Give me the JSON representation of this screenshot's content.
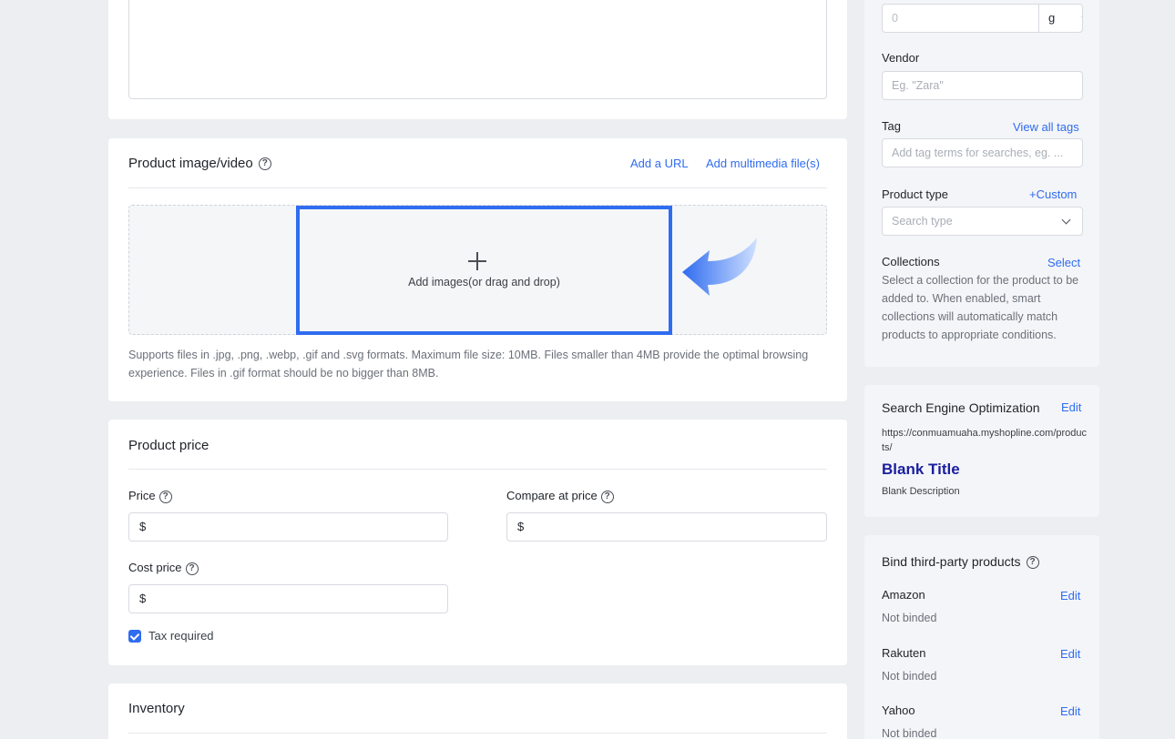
{
  "media": {
    "title": "Product image/video",
    "add_url": "Add a URL",
    "add_files": "Add multimedia file(s)",
    "drop_hint": "Add images(or drag and drop)",
    "support_text": "Supports files in .jpg, .png, .webp, .gif and .svg formats. Maximum file size: 10MB. Files smaller than 4MB provide the optimal browsing experience. Files in .gif format should be no bigger than 8MB."
  },
  "price": {
    "title": "Product price",
    "price_label": "Price",
    "compare_label": "Compare at price",
    "cost_label": "Cost price",
    "currency": "$",
    "tax_label": "Tax required",
    "tax_checked": true
  },
  "inventory": {
    "title": "Inventory"
  },
  "organization": {
    "weight_value": "0",
    "weight_unit": "g",
    "vendor_label": "Vendor",
    "vendor_placeholder": "Eg. \"Zara\"",
    "tag_label": "Tag",
    "tag_link": "View all tags",
    "tag_placeholder": "Add tag terms for searches, eg. ...",
    "type_label": "Product type",
    "type_link": "+Custom",
    "type_placeholder": "Search type",
    "collections_label": "Collections",
    "collections_link": "Select",
    "collections_desc": "Select a collection for the product to be added to. When enabled, smart collections will automatically match products to appropriate conditions."
  },
  "seo": {
    "title": "Search Engine Optimization",
    "edit": "Edit",
    "url": "https://conmuamuaha.myshopline.com/products/",
    "preview_title": "Blank Title",
    "preview_desc": "Blank Description"
  },
  "bind": {
    "title": "Bind third-party products",
    "edit": "Edit",
    "items": [
      {
        "name": "Amazon",
        "status": "Not binded"
      },
      {
        "name": "Rakuten",
        "status": "Not binded"
      },
      {
        "name": "Yahoo",
        "status": "Not binded"
      }
    ]
  },
  "colors": {
    "accent": "#2f6cf0",
    "seo_title": "#1a1f9e"
  }
}
